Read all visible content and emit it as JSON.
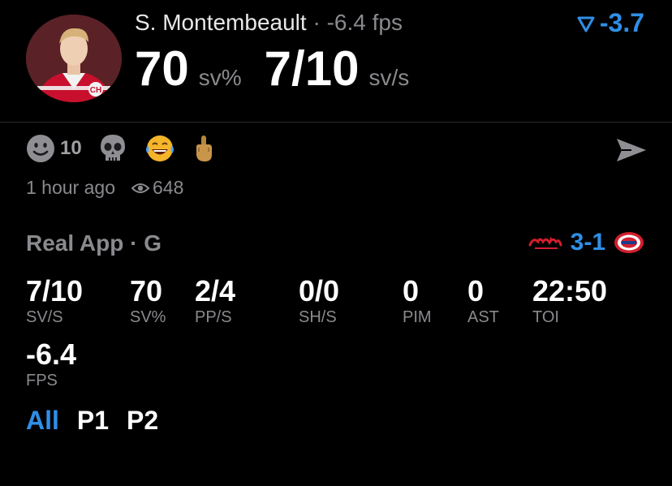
{
  "header": {
    "player_name": "S. Montembeault",
    "separator": " · ",
    "player_fps": "-6.4 fps",
    "trend_value": "-3.7",
    "save_pct_value": "70",
    "save_pct_unit": "sv%",
    "saves_value": "7/10",
    "saves_unit": "sv/s"
  },
  "reactions": [
    {
      "icon": "smiley-icon",
      "count": "10"
    },
    {
      "icon": "skull-icon",
      "count": ""
    },
    {
      "icon": "crying-laughing-icon",
      "count": ""
    },
    {
      "icon": "middle-finger-icon",
      "count": ""
    }
  ],
  "meta": {
    "time_ago": "1 hour ago",
    "views": "648"
  },
  "game": {
    "title": "Real App · G",
    "score": "3-1",
    "stats": [
      {
        "value": "7/10",
        "label": "SV/S"
      },
      {
        "value": "70",
        "label": "SV%"
      },
      {
        "value": "2/4",
        "label": "PP/S"
      },
      {
        "value": "0/0",
        "label": "SH/S"
      },
      {
        "value": "0",
        "label": "PIM"
      },
      {
        "value": "0",
        "label": "AST"
      },
      {
        "value": "22:50",
        "label": "TOI"
      },
      {
        "value": "-6.4",
        "label": "FPS"
      }
    ]
  },
  "tabs": [
    {
      "label": "All",
      "active": true
    },
    {
      "label": "P1",
      "active": false
    },
    {
      "label": "P2",
      "active": false
    }
  ],
  "colors": {
    "accent": "#2f8fe6",
    "muted": "#8a8a8e",
    "background": "#000000"
  }
}
